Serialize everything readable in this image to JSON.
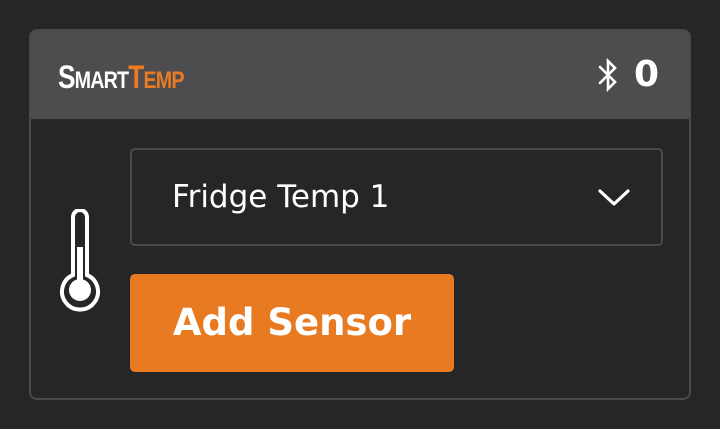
{
  "header": {
    "logo_smart": {
      "first": "S",
      "rest": "MART"
    },
    "logo_temp": {
      "first": "T",
      "rest": "EMP"
    },
    "bluetooth_icon": "bluetooth-icon",
    "bluetooth_count": "0"
  },
  "sensor_panel": {
    "thermometer_icon": "thermometer-icon",
    "selected_sensor": "Fridge Temp 1",
    "dropdown_icon": "chevron-down-icon",
    "add_button_label": "Add Sensor"
  },
  "colors": {
    "background": "#262628",
    "header": "#4d4d4f",
    "border": "#4a4a4c",
    "accent": "#e87a22",
    "text": "#ffffff"
  }
}
